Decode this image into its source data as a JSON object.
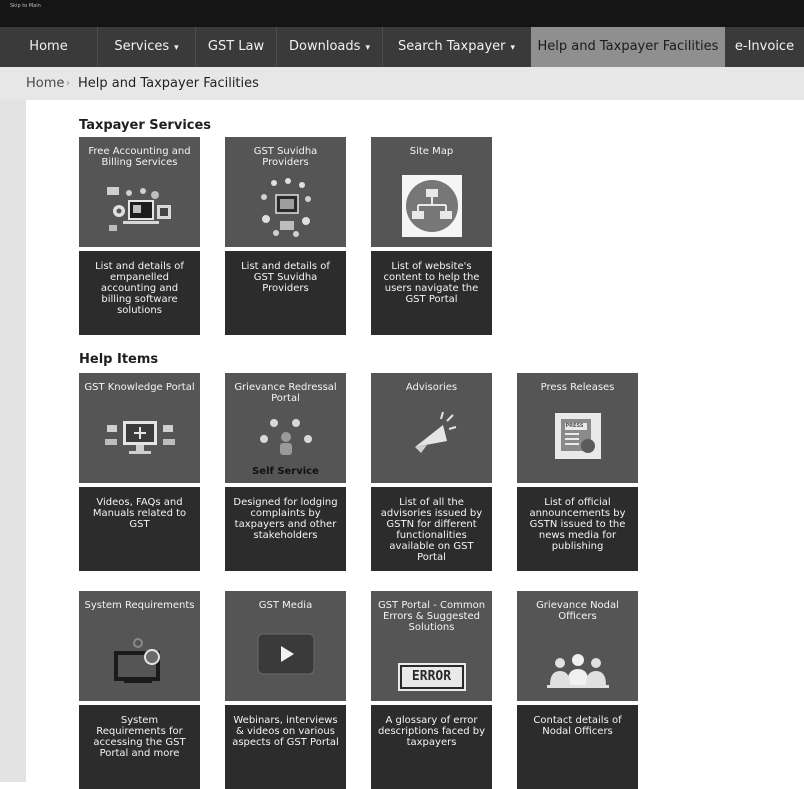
{
  "topbar": {
    "skip_text": "Skip to Main"
  },
  "nav": [
    {
      "label": "Home"
    },
    {
      "label": "Services",
      "caret": "▾"
    },
    {
      "label": "GST Law"
    },
    {
      "label": "Downloads",
      "caret": "▾"
    },
    {
      "label": "Search Taxpayer",
      "caret": "▾"
    },
    {
      "label": "Help and Taxpayer Facilities",
      "active": true
    },
    {
      "label": "e-Invoice"
    }
  ],
  "breadcrumb": {
    "home": "Home",
    "separator": "›",
    "current": "Help and Taxpayer Facilities"
  },
  "sections": [
    {
      "title": "Taxpayer Services",
      "tiles": [
        {
          "title": "Free Accounting and Billing Services",
          "icon": "accounting-devices-icon",
          "description": "List and details of empanelled accounting and billing software solutions"
        },
        {
          "title": "GST Suvidha Providers",
          "icon": "suvidha-network-icon",
          "description": "List and details of GST Suvidha Providers"
        },
        {
          "title": "Site Map",
          "icon": "sitemap-icon",
          "description": "List of website's content to help the users navigate the GST Portal"
        }
      ]
    },
    {
      "title": "Help Items",
      "tiles": [
        {
          "title": "GST Knowledge Portal",
          "icon": "knowledge-monitor-icon",
          "description": "Videos, FAQs and Manuals related to GST"
        },
        {
          "title": "Grievance Redressal Portal",
          "icon": "grievance-people-icon",
          "badge": "Self Service",
          "description": "Designed for lodging complaints by taxpayers and other stakeholders"
        },
        {
          "title": "Advisories",
          "icon": "megaphone-icon",
          "description": "List of all the advisories issued by GSTN for different functionalities available on GST Portal"
        },
        {
          "title": "Press Releases",
          "icon": "press-icon",
          "icon_text": "PRESS",
          "description": "List of official announcements by GSTN issued to the news media for publishing"
        },
        {
          "title": "System Requirements",
          "icon": "system-monitor-icon",
          "description": "System Requirements for accessing the GST Portal and more"
        },
        {
          "title": "GST Media",
          "icon": "play-button-icon",
          "description": "Webinars, interviews & videos on various aspects of GST Portal"
        },
        {
          "title": "GST Portal - Common Errors & Suggested Solutions",
          "icon": "error-sign-icon",
          "icon_text": "ERROR",
          "description": "A glossary of error descriptions faced by taxpayers"
        },
        {
          "title": "Grievance Nodal Officers",
          "icon": "officers-group-icon",
          "description": "Contact details of Nodal Officers"
        }
      ]
    }
  ]
}
